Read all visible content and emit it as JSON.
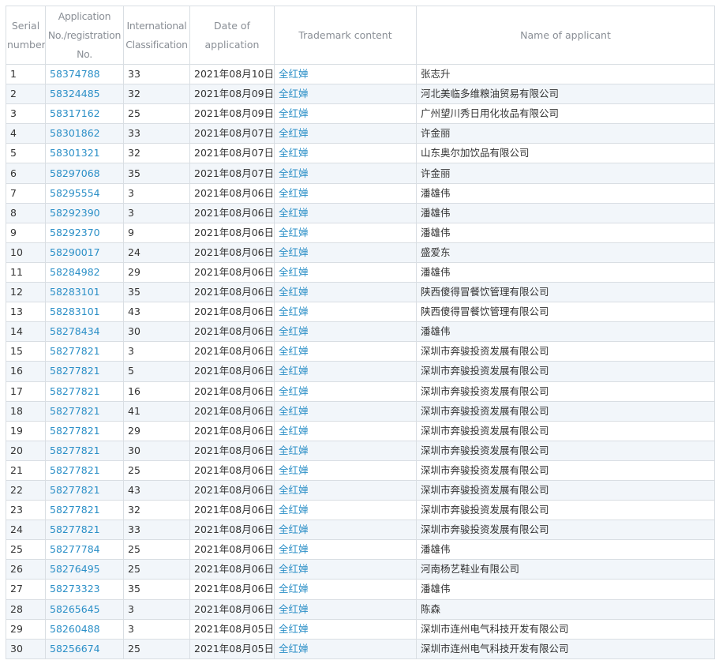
{
  "table": {
    "headers": [
      "Serial number",
      "Application No./registration No.",
      "International Classification",
      "Date of application",
      "Trademark content",
      "Name of applicant"
    ],
    "rows": [
      {
        "serial": "1",
        "app_no": "58374788",
        "class": "33",
        "date": "2021年08月10日",
        "trademark": "全红婵",
        "applicant": "张志升"
      },
      {
        "serial": "2",
        "app_no": "58324485",
        "class": "32",
        "date": "2021年08月09日",
        "trademark": "全红婵",
        "applicant": "河北美临多维粮油贸易有限公司"
      },
      {
        "serial": "3",
        "app_no": "58317162",
        "class": "25",
        "date": "2021年08月09日",
        "trademark": "全红婵",
        "applicant": "广州望川秀日用化妆品有限公司"
      },
      {
        "serial": "4",
        "app_no": "58301862",
        "class": "33",
        "date": "2021年08月07日",
        "trademark": "全红婵",
        "applicant": "许金丽"
      },
      {
        "serial": "5",
        "app_no": "58301321",
        "class": "32",
        "date": "2021年08月07日",
        "trademark": "全红婵",
        "applicant": "山东奥尔加饮品有限公司"
      },
      {
        "serial": "6",
        "app_no": "58297068",
        "class": "35",
        "date": "2021年08月07日",
        "trademark": "全红婵",
        "applicant": "许金丽"
      },
      {
        "serial": "7",
        "app_no": "58295554",
        "class": "3",
        "date": "2021年08月06日",
        "trademark": "全红婵",
        "applicant": "潘雄伟"
      },
      {
        "serial": "8",
        "app_no": "58292390",
        "class": "3",
        "date": "2021年08月06日",
        "trademark": "全红婵",
        "applicant": "潘雄伟"
      },
      {
        "serial": "9",
        "app_no": "58292370",
        "class": "9",
        "date": "2021年08月06日",
        "trademark": "全红婵",
        "applicant": "潘雄伟"
      },
      {
        "serial": "10",
        "app_no": "58290017",
        "class": "24",
        "date": "2021年08月06日",
        "trademark": "全红婵",
        "applicant": "盛爱东"
      },
      {
        "serial": "11",
        "app_no": "58284982",
        "class": "29",
        "date": "2021年08月06日",
        "trademark": "全红婵",
        "applicant": "潘雄伟"
      },
      {
        "serial": "12",
        "app_no": "58283101",
        "class": "35",
        "date": "2021年08月06日",
        "trademark": "全红婵",
        "applicant": "陕西傻得冒餐饮管理有限公司"
      },
      {
        "serial": "13",
        "app_no": "58283101",
        "class": "43",
        "date": "2021年08月06日",
        "trademark": "全红婵",
        "applicant": "陕西傻得冒餐饮管理有限公司"
      },
      {
        "serial": "14",
        "app_no": "58278434",
        "class": "30",
        "date": "2021年08月06日",
        "trademark": "全红婵",
        "applicant": "潘雄伟"
      },
      {
        "serial": "15",
        "app_no": "58277821",
        "class": "3",
        "date": "2021年08月06日",
        "trademark": "全红婵",
        "applicant": "深圳市奔骏投资发展有限公司"
      },
      {
        "serial": "16",
        "app_no": "58277821",
        "class": "5",
        "date": "2021年08月06日",
        "trademark": "全红婵",
        "applicant": "深圳市奔骏投资发展有限公司"
      },
      {
        "serial": "17",
        "app_no": "58277821",
        "class": "16",
        "date": "2021年08月06日",
        "trademark": "全红婵",
        "applicant": "深圳市奔骏投资发展有限公司"
      },
      {
        "serial": "18",
        "app_no": "58277821",
        "class": "41",
        "date": "2021年08月06日",
        "trademark": "全红婵",
        "applicant": "深圳市奔骏投资发展有限公司"
      },
      {
        "serial": "19",
        "app_no": "58277821",
        "class": "29",
        "date": "2021年08月06日",
        "trademark": "全红婵",
        "applicant": "深圳市奔骏投资发展有限公司"
      },
      {
        "serial": "20",
        "app_no": "58277821",
        "class": "30",
        "date": "2021年08月06日",
        "trademark": "全红婵",
        "applicant": "深圳市奔骏投资发展有限公司"
      },
      {
        "serial": "21",
        "app_no": "58277821",
        "class": "25",
        "date": "2021年08月06日",
        "trademark": "全红婵",
        "applicant": "深圳市奔骏投资发展有限公司"
      },
      {
        "serial": "22",
        "app_no": "58277821",
        "class": "43",
        "date": "2021年08月06日",
        "trademark": "全红婵",
        "applicant": "深圳市奔骏投资发展有限公司"
      },
      {
        "serial": "23",
        "app_no": "58277821",
        "class": "32",
        "date": "2021年08月06日",
        "trademark": "全红婵",
        "applicant": "深圳市奔骏投资发展有限公司"
      },
      {
        "serial": "24",
        "app_no": "58277821",
        "class": "33",
        "date": "2021年08月06日",
        "trademark": "全红婵",
        "applicant": "深圳市奔骏投资发展有限公司"
      },
      {
        "serial": "25",
        "app_no": "58277784",
        "class": "25",
        "date": "2021年08月06日",
        "trademark": "全红婵",
        "applicant": "潘雄伟"
      },
      {
        "serial": "26",
        "app_no": "58276495",
        "class": "25",
        "date": "2021年08月06日",
        "trademark": "全红婵",
        "applicant": "河南杨艺鞋业有限公司"
      },
      {
        "serial": "27",
        "app_no": "58273323",
        "class": "35",
        "date": "2021年08月06日",
        "trademark": "全红婵",
        "applicant": "潘雄伟"
      },
      {
        "serial": "28",
        "app_no": "58265645",
        "class": "3",
        "date": "2021年08月06日",
        "trademark": "全红婵",
        "applicant": "陈森"
      },
      {
        "serial": "29",
        "app_no": "58260488",
        "class": "3",
        "date": "2021年08月05日",
        "trademark": "全红婵",
        "applicant": "深圳市连州电气科技开发有限公司"
      },
      {
        "serial": "30",
        "app_no": "58256674",
        "class": "25",
        "date": "2021年08月05日",
        "trademark": "全红婵",
        "applicant": "深圳市连州电气科技开发有限公司"
      }
    ]
  }
}
